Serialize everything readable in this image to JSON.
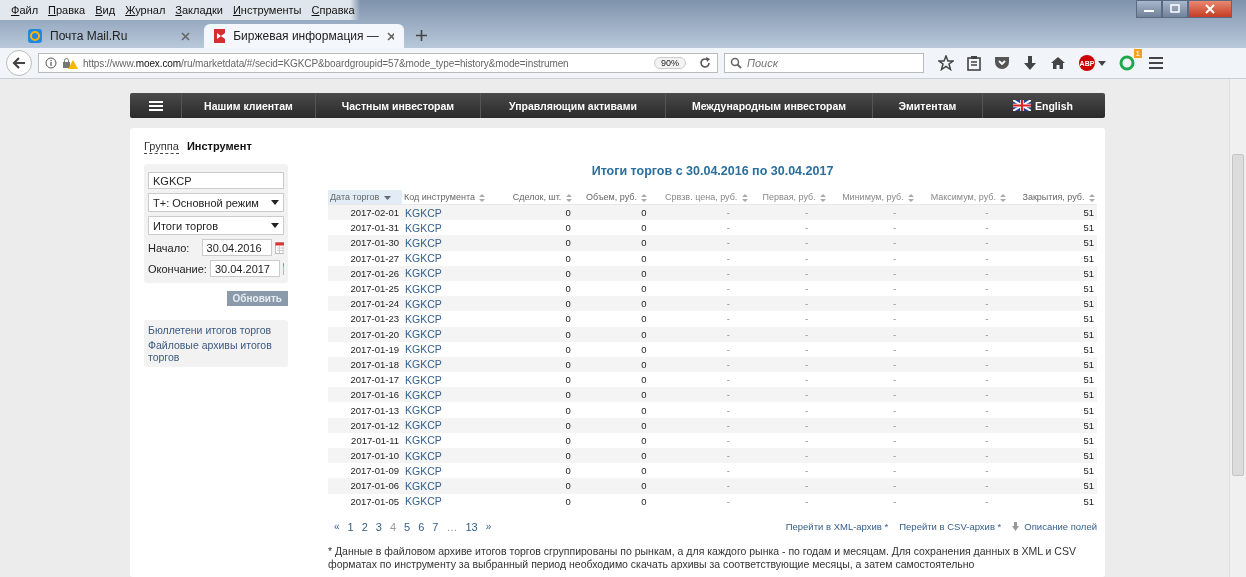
{
  "menu_bar": [
    "Файл",
    "Правка",
    "Вид",
    "Журнал",
    "Закладки",
    "Инструменты",
    "Справка"
  ],
  "tabs": [
    {
      "label": "Почта Mail.Ru",
      "kind": "mail",
      "selected": false
    },
    {
      "label": "Биржевая информация —",
      "kind": "moex",
      "selected": true
    }
  ],
  "toolbar": {
    "url_host_prefix": "https://www.",
    "url_host": "moex.com",
    "url_rest": "/ru/marketdata/#/secid=KGKCP&boardgroupid=57&mode_type=history&mode=instrumen",
    "zoom": "90%",
    "search": {
      "placeholder": "Поиск"
    },
    "adblock_label": "ABP",
    "badge": "1"
  },
  "site_nav": [
    "Нашим клиентам",
    "Частным инвесторам",
    "Управляющим активами",
    "Международным инвесторам",
    "Эмитентам",
    "English"
  ],
  "mode_tabs": [
    {
      "label": "Группа",
      "selected": false
    },
    {
      "label": "Инструмент",
      "selected": true
    }
  ],
  "filters": {
    "instrument": "KGKCP",
    "mode": "Т+: Основной режим",
    "report": "Итоги торгов",
    "start_label": "Начало:",
    "start": "30.04.2016",
    "end_label": "Окончание:",
    "end": "30.04.2017",
    "refresh": "Обновить"
  },
  "side_links": [
    "Бюллетени итогов торгов",
    "Файловые архивы итогов торгов"
  ],
  "table": {
    "title": "Итоги торгов с 30.04.2016 по 30.04.2017",
    "columns": [
      {
        "label": "Дата торгов",
        "sorted": true
      },
      {
        "label": "Код инструмента",
        "sorted": false
      },
      {
        "label": "Сделок, шт.",
        "sorted": false
      },
      {
        "label": "Объем, руб.",
        "sorted": false
      },
      {
        "label": "Срвзв. цена, руб.",
        "sorted": false
      },
      {
        "label": "Первая, руб.",
        "sorted": false
      },
      {
        "label": "Минимум, руб.",
        "sorted": false
      },
      {
        "label": "Максимум, руб.",
        "sorted": false
      },
      {
        "label": "Закрытия, руб.",
        "sorted": false
      }
    ],
    "rows": [
      [
        "2017-02-01",
        "KGKCP",
        "0",
        "0",
        "-",
        "-",
        "-",
        "-",
        "51"
      ],
      [
        "2017-01-31",
        "KGKCP",
        "0",
        "0",
        "-",
        "-",
        "-",
        "-",
        "51"
      ],
      [
        "2017-01-30",
        "KGKCP",
        "0",
        "0",
        "-",
        "-",
        "-",
        "-",
        "51"
      ],
      [
        "2017-01-27",
        "KGKCP",
        "0",
        "0",
        "-",
        "-",
        "-",
        "-",
        "51"
      ],
      [
        "2017-01-26",
        "KGKCP",
        "0",
        "0",
        "-",
        "-",
        "-",
        "-",
        "51"
      ],
      [
        "2017-01-25",
        "KGKCP",
        "0",
        "0",
        "-",
        "-",
        "-",
        "-",
        "51"
      ],
      [
        "2017-01-24",
        "KGKCP",
        "0",
        "0",
        "-",
        "-",
        "-",
        "-",
        "51"
      ],
      [
        "2017-01-23",
        "KGKCP",
        "0",
        "0",
        "-",
        "-",
        "-",
        "-",
        "51"
      ],
      [
        "2017-01-20",
        "KGKCP",
        "0",
        "0",
        "-",
        "-",
        "-",
        "-",
        "51"
      ],
      [
        "2017-01-19",
        "KGKCP",
        "0",
        "0",
        "-",
        "-",
        "-",
        "-",
        "51"
      ],
      [
        "2017-01-18",
        "KGKCP",
        "0",
        "0",
        "-",
        "-",
        "-",
        "-",
        "51"
      ],
      [
        "2017-01-17",
        "KGKCP",
        "0",
        "0",
        "-",
        "-",
        "-",
        "-",
        "51"
      ],
      [
        "2017-01-16",
        "KGKCP",
        "0",
        "0",
        "-",
        "-",
        "-",
        "-",
        "51"
      ],
      [
        "2017-01-13",
        "KGKCP",
        "0",
        "0",
        "-",
        "-",
        "-",
        "-",
        "51"
      ],
      [
        "2017-01-12",
        "KGKCP",
        "0",
        "0",
        "-",
        "-",
        "-",
        "-",
        "51"
      ],
      [
        "2017-01-11",
        "KGKCP",
        "0",
        "0",
        "-",
        "-",
        "-",
        "-",
        "51"
      ],
      [
        "2017-01-10",
        "KGKCP",
        "0",
        "0",
        "-",
        "-",
        "-",
        "-",
        "51"
      ],
      [
        "2017-01-09",
        "KGKCP",
        "0",
        "0",
        "-",
        "-",
        "-",
        "-",
        "51"
      ],
      [
        "2017-01-06",
        "KGKCP",
        "0",
        "0",
        "-",
        "-",
        "-",
        "-",
        "51"
      ],
      [
        "2017-01-05",
        "KGKCP",
        "0",
        "0",
        "-",
        "-",
        "-",
        "-",
        "51"
      ]
    ]
  },
  "pagination": [
    {
      "label": "«",
      "kind": "arrow",
      "selected": false
    },
    {
      "label": "1",
      "kind": "page",
      "selected": false
    },
    {
      "label": "2",
      "kind": "page",
      "selected": false
    },
    {
      "label": "3",
      "kind": "page",
      "selected": false
    },
    {
      "label": "4",
      "kind": "page",
      "selected": true
    },
    {
      "label": "5",
      "kind": "page",
      "selected": false
    },
    {
      "label": "6",
      "kind": "page",
      "selected": false
    },
    {
      "label": "7",
      "kind": "page",
      "selected": false
    },
    {
      "label": "…",
      "kind": "gap"
    },
    {
      "label": "13",
      "kind": "page",
      "selected": false
    },
    {
      "label": "»",
      "kind": "arrow",
      "selected": false
    }
  ],
  "export_links": [
    {
      "label": "Перейти в XML-архив *",
      "kind": "link"
    },
    {
      "label": "Перейти в CSV-архив *",
      "kind": "link"
    },
    {
      "label": "Описание полей",
      "kind": "download"
    }
  ],
  "footnote": "* Данные в файловом архиве итогов торгов сгруппированы по рынкам, а для каждого рынка - по годам и месяцам. Для сохранения данных в XML и CSV форматах по инструменту за выбранный период необходимо скачать архивы за соответствующие месяцы, а затем самостоятельно"
}
